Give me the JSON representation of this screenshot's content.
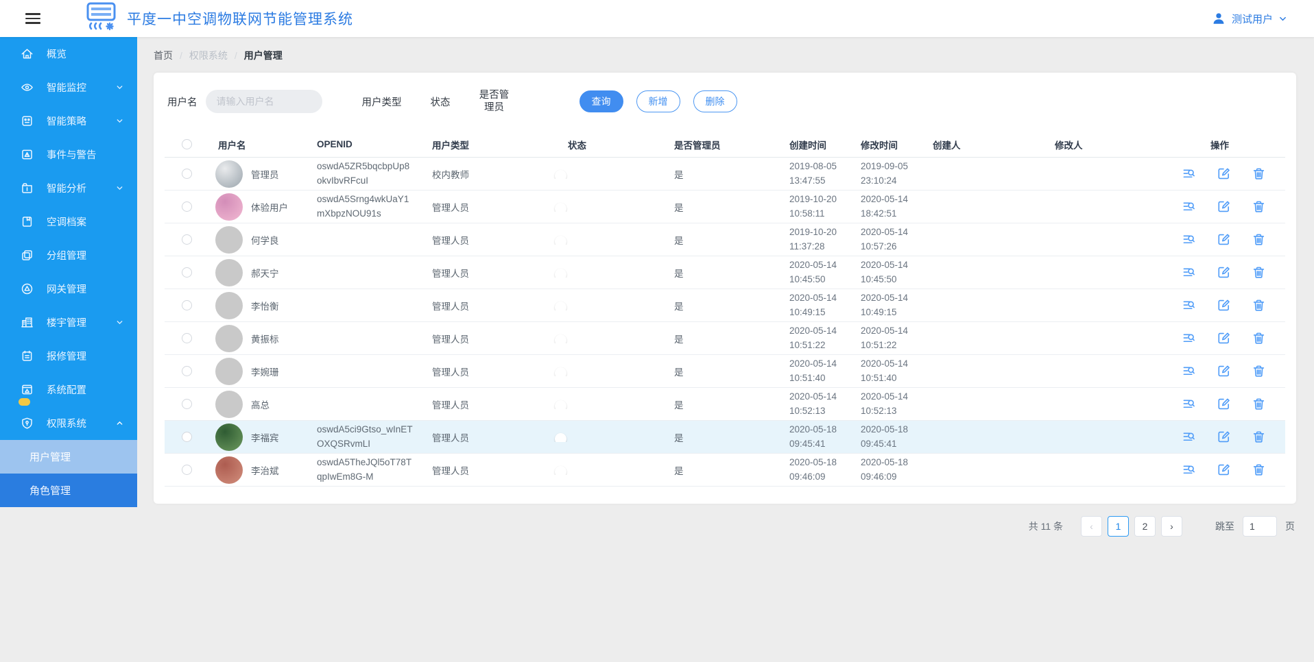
{
  "colors": {
    "accent": "#1e9fff",
    "sidebar": "#1a9bf0",
    "brand_text": "#2b7be2",
    "primary_button": "#418df0",
    "highlight_row": "#e7f4fb",
    "badge_yellow": "#f3c845"
  },
  "header": {
    "title": "平度一中空调物联网节能管理系统",
    "user_name": "测试用户"
  },
  "breadcrumb": [
    "首页",
    "权限系统",
    "用户管理"
  ],
  "sidebar": {
    "items": [
      {
        "id": "overview",
        "label": "概览",
        "icon": "home"
      },
      {
        "id": "monitor",
        "label": "智能监控",
        "icon": "eye",
        "arrow": "down"
      },
      {
        "id": "strategy",
        "label": "智能策略",
        "icon": "strategy",
        "arrow": "down"
      },
      {
        "id": "events",
        "label": "事件与警告",
        "icon": "alert"
      },
      {
        "id": "analysis",
        "label": "智能分析",
        "icon": "analysis",
        "arrow": "down"
      },
      {
        "id": "ac-archive",
        "label": "空调档案",
        "icon": "archive"
      },
      {
        "id": "groups",
        "label": "分组管理",
        "icon": "group"
      },
      {
        "id": "gateway",
        "label": "网关管理",
        "icon": "gateway"
      },
      {
        "id": "building",
        "label": "楼宇管理",
        "icon": "building",
        "arrow": "down"
      },
      {
        "id": "repair",
        "label": "报修管理",
        "icon": "repair"
      },
      {
        "id": "sysconfig",
        "label": "系统配置",
        "icon": "config",
        "badge": true
      },
      {
        "id": "permission",
        "label": "权限系统",
        "icon": "permission",
        "arrow": "up"
      },
      {
        "id": "user-mgmt",
        "label": "用户管理",
        "type": "subitem",
        "active": true
      },
      {
        "id": "role-mgmt",
        "label": "角色管理",
        "type": "subitem"
      }
    ]
  },
  "filters": {
    "username_label": "用户名",
    "username_placeholder": "请输入用户名",
    "username_value": "",
    "usertype_label": "用户类型",
    "status_label": "状态",
    "admin_label": "是否管理员",
    "search_button": "查询",
    "add_button": "新增",
    "delete_button": "删除"
  },
  "table": {
    "columns": [
      "用户名",
      "OPENID",
      "用户类型",
      "状态",
      "是否管理员",
      "创建时间",
      "修改时间",
      "创建人",
      "修改人",
      "操作"
    ],
    "row_actions": [
      "detail-icon",
      "edit-icon",
      "delete-icon"
    ],
    "rows": [
      {
        "name": "管理员",
        "openid": "oswdA5ZR5bqcbpUp8okvIbvRFcuI",
        "type": "校内教师",
        "status": true,
        "admin": "是",
        "created": "2019-08-05 13:47:55",
        "modified": "2019-09-05 23:10:24",
        "creator": "",
        "modifier": "",
        "avatar": [
          "#9aa4ac",
          "#e9ebed"
        ],
        "highlight": false
      },
      {
        "name": "体验用户",
        "openid": "oswdA5Srng4wkUaY1mXbpzNOU91s",
        "type": "管理人员",
        "status": true,
        "admin": "是",
        "created": "2019-10-20 10:58:11",
        "modified": "2020-05-14 18:42:51",
        "creator": "",
        "modifier": "",
        "avatar": [
          "#f2b9d2",
          "#d38db8"
        ],
        "highlight": false
      },
      {
        "name": "何学良",
        "openid": "",
        "type": "管理人员",
        "status": true,
        "admin": "是",
        "created": "2019-10-20 11:37:28",
        "modified": "2020-05-14 10:57:26",
        "creator": "",
        "modifier": "",
        "avatar": [
          "#c9c9c9",
          "#c9c9c9"
        ],
        "highlight": false
      },
      {
        "name": "郝天宁",
        "openid": "",
        "type": "管理人员",
        "status": true,
        "admin": "是",
        "created": "2020-05-14 10:45:50",
        "modified": "2020-05-14 10:45:50",
        "creator": "",
        "modifier": "",
        "avatar": [
          "#c9c9c9",
          "#c9c9c9"
        ],
        "highlight": false
      },
      {
        "name": "李怡衡",
        "openid": "",
        "type": "管理人员",
        "status": true,
        "admin": "是",
        "created": "2020-05-14 10:49:15",
        "modified": "2020-05-14 10:49:15",
        "creator": "",
        "modifier": "",
        "avatar": [
          "#c9c9c9",
          "#c9c9c9"
        ],
        "highlight": false
      },
      {
        "name": "黄振标",
        "openid": "",
        "type": "管理人员",
        "status": true,
        "admin": "是",
        "created": "2020-05-14 10:51:22",
        "modified": "2020-05-14 10:51:22",
        "creator": "",
        "modifier": "",
        "avatar": [
          "#c9c9c9",
          "#c9c9c9"
        ],
        "highlight": false
      },
      {
        "name": "李婉珊",
        "openid": "",
        "type": "管理人员",
        "status": true,
        "admin": "是",
        "created": "2020-05-14 10:51:40",
        "modified": "2020-05-14 10:51:40",
        "creator": "",
        "modifier": "",
        "avatar": [
          "#c9c9c9",
          "#c9c9c9"
        ],
        "highlight": false
      },
      {
        "name": "高总",
        "openid": "",
        "type": "管理人员",
        "status": true,
        "admin": "是",
        "created": "2020-05-14 10:52:13",
        "modified": "2020-05-14 10:52:13",
        "creator": "",
        "modifier": "",
        "avatar": [
          "#c9c9c9",
          "#c9c9c9"
        ],
        "highlight": false
      },
      {
        "name": "李福宾",
        "openid": "oswdA5ci9Gtso_wInETOXQSRvmLI",
        "type": "管理人员",
        "status": true,
        "admin": "是",
        "created": "2020-05-18 09:45:41",
        "modified": "2020-05-18 09:45:41",
        "creator": "",
        "modifier": "",
        "avatar": [
          "#6d9a5e",
          "#2f5c33"
        ],
        "highlight": true
      },
      {
        "name": "李治斌",
        "openid": "oswdA5TheJQl5oT78TqpIwEm8G-M",
        "type": "管理人员",
        "status": true,
        "admin": "是",
        "created": "2020-05-18 09:46:09",
        "modified": "2020-05-18 09:46:09",
        "creator": "",
        "modifier": "",
        "avatar": [
          "#d28f7d",
          "#ad5c50"
        ],
        "highlight": false
      }
    ]
  },
  "pagination": {
    "total_text": "共 11 条",
    "pages": [
      "1",
      "2"
    ],
    "current_page": "1",
    "prev_label": "‹",
    "next_label": "›",
    "jump_label": "跳至",
    "jump_value": "1",
    "page_word": "页"
  }
}
